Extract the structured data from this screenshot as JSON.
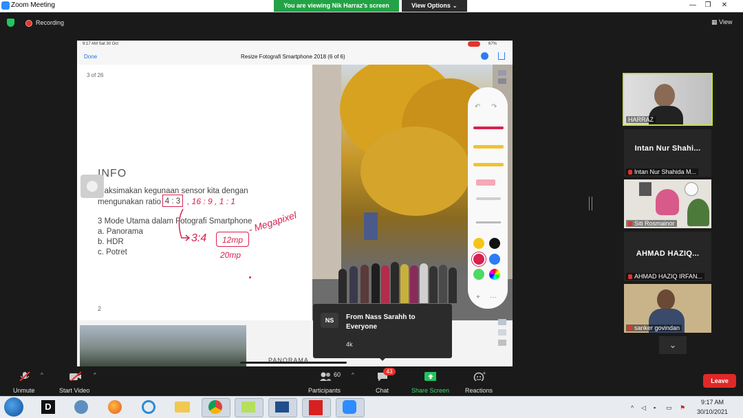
{
  "window": {
    "app_title": "Zoom Meeting",
    "share_banner": "You are viewing Nik Harraz's screen",
    "view_options_label": "View Options",
    "minimize": "—",
    "restore": "❐",
    "close": "✕"
  },
  "meeting_bar": {
    "recording_label": "Recording",
    "view_label": "View"
  },
  "shared_screen": {
    "ipad_time": "9:17 AM  Sat 30 Oct",
    "ipad_battery": "67%",
    "done_label": "Done",
    "doc_title": "Resize Fotografi Smartphone 2018 (6 of 6)",
    "page_indicator": "3 of 26",
    "slide": {
      "heading": "INFO",
      "line1": "Maksimakan kegunaan sensor kita dengan",
      "line2_prefix": "mengunakan ratio",
      "ratio_boxed": "4 : 3",
      "ratio_handwritten": ",  16 : 9  ,  1 : 1",
      "list_title": "3 Mode Utama dalam Fotografi Smartphone",
      "items": [
        "a. Panorama",
        "b. HDR",
        "c. Potret"
      ],
      "handwritten_ratio": "3:4",
      "handwritten_mp": "12mp",
      "handwritten_megapixel": "- Megapixel",
      "handwritten_20mp": "20mp",
      "slide_number": "2"
    },
    "bottom_label": "PANORAMA"
  },
  "chat_toast": {
    "avatar_initials": "NS",
    "sender": "From Nass Sarahh to Everyone",
    "message": "4k"
  },
  "participants": [
    {
      "name": "HARRAZ",
      "type": "video",
      "active_speaker": true
    },
    {
      "big_name": "Intan Nur Shahi...",
      "name": "Intan Nur Shahida M...",
      "type": "name",
      "muted": true
    },
    {
      "name": "Siti Rosmainor",
      "type": "video",
      "muted": true
    },
    {
      "big_name": "AHMAD HAZIQ...",
      "name": "AHMAD HAZIQ IRFAN...",
      "type": "name",
      "muted": true
    },
    {
      "name": "sanker govindan",
      "type": "video",
      "muted": true
    }
  ],
  "toolbar": {
    "unmute": "Unmute",
    "start_video": "Start Video",
    "participants": "Participants",
    "participants_count": "60",
    "chat": "Chat",
    "chat_badge": "43",
    "share_screen": "Share Screen",
    "reactions": "Reactions",
    "leave": "Leave"
  },
  "taskbar": {
    "time": "9:17 AM",
    "date": "30/10/2021"
  },
  "colors": {
    "share_green": "#22a345",
    "speaker_border": "#c6e036",
    "leave_red": "#e02828",
    "badge_red": "#e5332a",
    "annotation_red": "#d6224e"
  }
}
